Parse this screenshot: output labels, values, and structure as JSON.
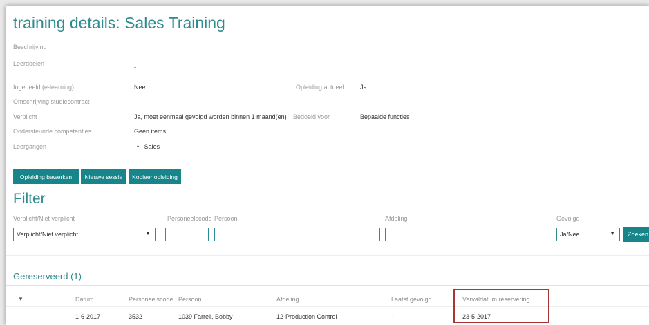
{
  "page": {
    "title": "training details: Sales Training"
  },
  "details": {
    "beschrijving_label": "Beschrijving",
    "leerdoelen_label": "Leerdoelen",
    "leerdoelen_value": "-",
    "ingedeeld_label": "Ingedeeld (e-learning)",
    "ingedeeld_value": "Nee",
    "opleiding_actueel_label": "Opleiding actueel",
    "opleiding_actueel_value": "Ja",
    "omschrijving_label": "Omschrijving studiecontract",
    "verplicht_label": "Verplicht",
    "verplicht_value": "Ja, moet eenmaal gevolgd worden binnen 1 maand(en)",
    "bedoeld_voor_label": "Bedoeld voor",
    "bedoeld_voor_value": "Bepaalde functies",
    "competenties_label": "Ondersteunde competenties",
    "competenties_value": "Geen items",
    "leergangen_label": "Leergangen",
    "leergangen_items": [
      "Sales"
    ]
  },
  "actions": {
    "edit_label": "Opleiding bewerken",
    "new_session_label": "Nieuwe sessie",
    "copy_label": "Kopieer opleiding"
  },
  "filter": {
    "title": "Filter",
    "verplicht_label": "Verplicht/Niet verplicht",
    "verplicht_selected": "Verplicht/Niet verplicht",
    "personeelscode_label": "Personeelscode",
    "personeelscode_value": "",
    "persoon_label": "Persoon",
    "persoon_value": "",
    "afdeling_label": "Afdeling",
    "afdeling_value": "",
    "gevolgd_label": "Gevolgd",
    "gevolgd_selected": "Ja/Nee",
    "search_label": "Zoeken"
  },
  "reserved": {
    "title": "Gereserveerd (1)",
    "columns": [
      "Datum",
      "Personeelscode",
      "Persoon",
      "Afdeling",
      "Laatst gevolgd",
      "Vervaldatum reservering"
    ],
    "rows": [
      {
        "datum": "1-6-2017",
        "personeelscode": "3532",
        "persoon": "1039 Farrell, Bobby",
        "afdeling": "12-Production Control",
        "laatst_gevolgd": "-",
        "vervaldatum": "23-5-2017"
      }
    ]
  },
  "colors": {
    "accent": "#17858a",
    "heading": "#2e8b8f",
    "highlight_border": "#a93535"
  },
  "icons": {
    "select_arrow": "triangle-down-icon",
    "collapse": "caret-down-icon"
  }
}
